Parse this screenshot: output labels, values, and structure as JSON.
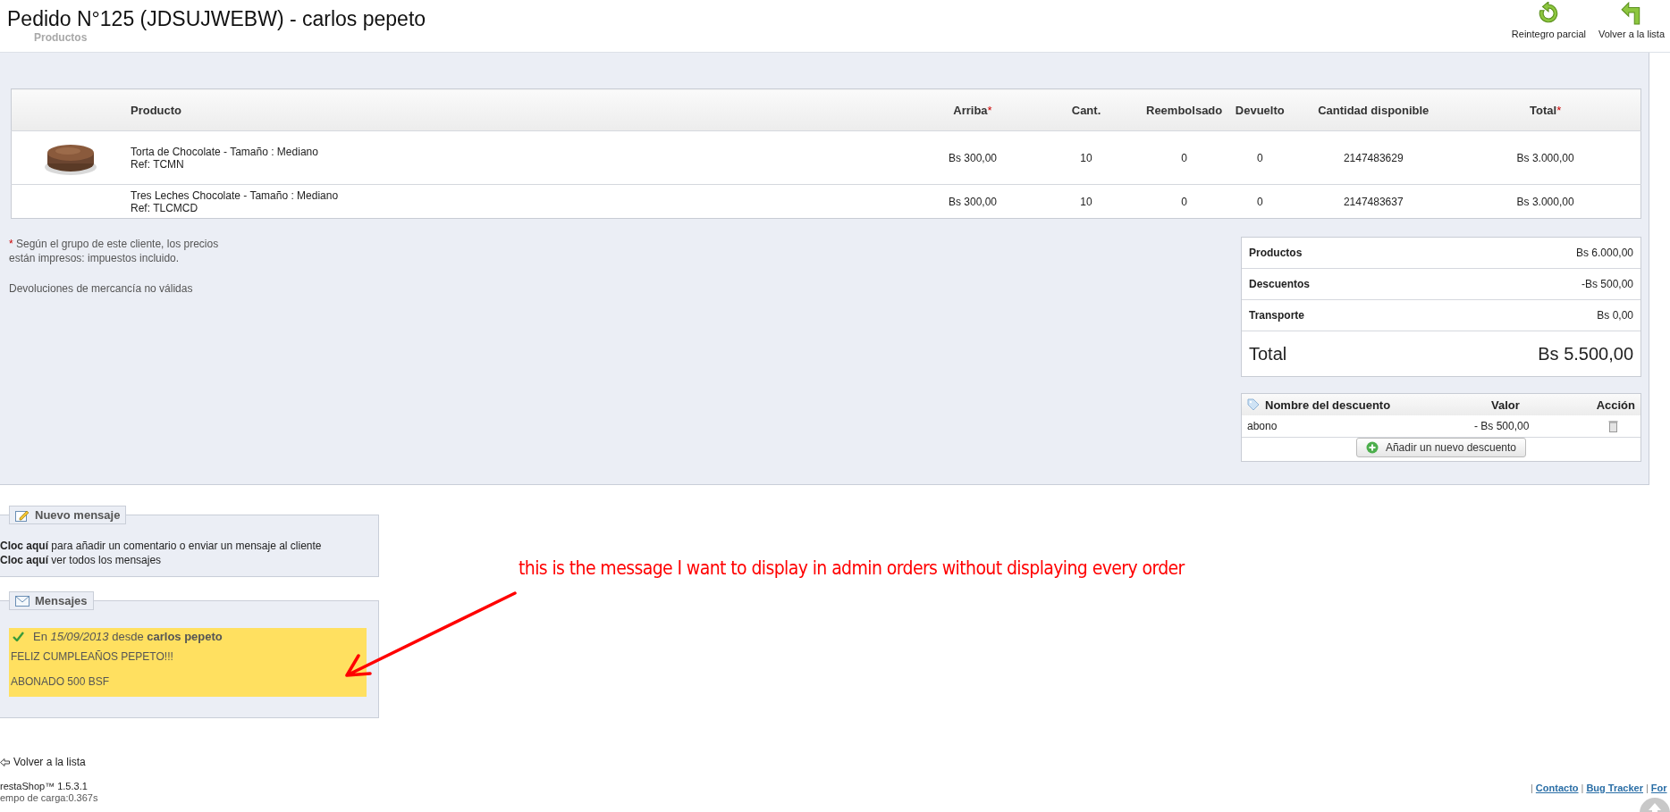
{
  "page_title": "Pedido N°125 (JDSUJWEBW) - carlos pepeto",
  "faded_heading": "Productos",
  "toolbar": [
    {
      "label": "Reintegro parcial",
      "kind": "refund"
    },
    {
      "label": "Volver a la lista",
      "kind": "back"
    }
  ],
  "products_table": {
    "columns": [
      {
        "label": "Producto",
        "required": false
      },
      {
        "label": "Arriba",
        "required": true
      },
      {
        "label": "Cant.",
        "required": false
      },
      {
        "label": "Reembolsado",
        "required": false
      },
      {
        "label": "Devuelto",
        "required": false
      },
      {
        "label": "Cantidad disponible",
        "required": false
      },
      {
        "label": "Total",
        "required": true
      }
    ],
    "rows": [
      {
        "image": true,
        "ref": "Ref: TCMN",
        "cells": [
          "Torta de Chocolate - Tamaño : Mediano",
          "Bs 300,00",
          "10",
          "0",
          "0",
          "2147483629",
          "Bs 3.000,00"
        ]
      },
      {
        "image": false,
        "ref": "Ref: TLCMCD",
        "cells": [
          "Tres Leches Chocolate - Tamaño : Mediano",
          "Bs 300,00",
          "10",
          "0",
          "0",
          "2147483637",
          "Bs 3.000,00"
        ]
      }
    ]
  },
  "notes": {
    "mark": "*",
    "tax_note": "Según el grupo de este cliente, los precios",
    "tax_note_2": "están impresos: impuestos incluido.",
    "returns_note": "Devoluciones de mercancía no válidas"
  },
  "totals": [
    {
      "label": "Productos",
      "value": "Bs 6.000,00",
      "kind": "line"
    },
    {
      "label": "Descuentos",
      "value": "-Bs 500,00",
      "kind": "line"
    },
    {
      "label": "Transporte",
      "value": "Bs 0,00",
      "kind": "line"
    },
    {
      "label": "Total",
      "value": "Bs 5.500,00",
      "kind": "grand"
    }
  ],
  "discounts": {
    "columns": [
      "Nombre del descuento",
      "Valor",
      "Acción"
    ],
    "rows": [
      {
        "name": "abono",
        "value": "- Bs 500,00"
      }
    ],
    "add_button": "Añadir un nuevo descuento"
  },
  "new_message": {
    "legend": "Nuevo mensaje",
    "lines": [
      "**Cloc aquí** para añadir un comentario o enviar un mensaje al cliente",
      "**Cloc aquí** ver todos los mensajes"
    ]
  },
  "messages": {
    "legend": "Mensajes",
    "items": [
      {
        "header": "En *15/09/2013* desde **carlos pepeto**",
        "lines": [
          "FELIZ CUMPLEAÑOS PEPETO!!!",
          "ABONADO 500 BSF"
        ]
      }
    ]
  },
  "annotation": {
    "text": "this is the message I want to display in admin orders without displaying every order"
  },
  "footer": {
    "back_link": "Volver a la lista",
    "version": "restaShop™ 1.5.3.1",
    "load_time": "empo de carga:0.367s",
    "links": [
      {
        "separator": "|",
        "label": "Contacto"
      },
      {
        "separator": "|",
        "label": "Bug Tracker"
      },
      {
        "separator": "|",
        "label": "For"
      }
    ]
  }
}
